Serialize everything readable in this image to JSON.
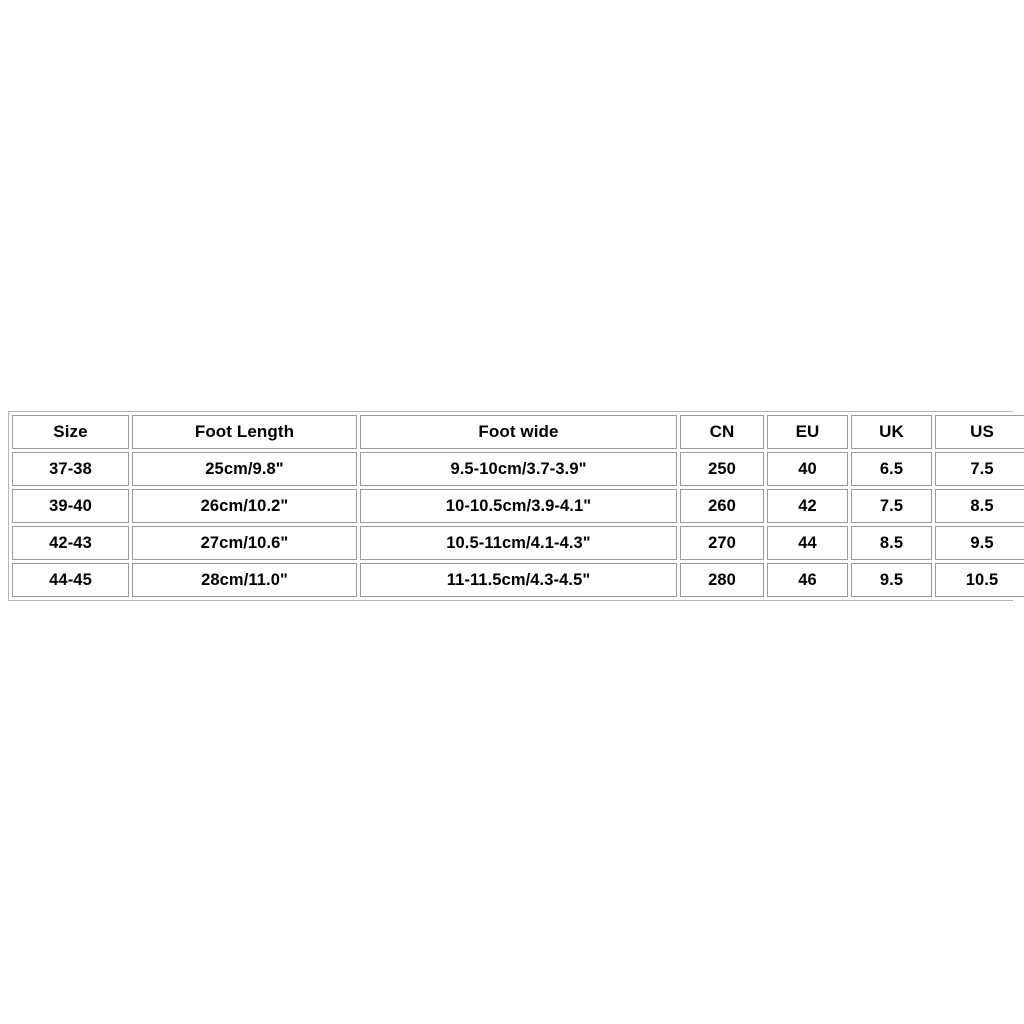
{
  "page": {
    "background_color": "#ffffff",
    "text_color": "#000000",
    "border_color": "#9a9a9a",
    "outer_border_color": "#b4b4b4"
  },
  "size_chart": {
    "headers": [
      "Size",
      "Foot Length",
      "Foot wide",
      "CN",
      "EU",
      "UK",
      "US"
    ],
    "rows": [
      {
        "size": "37-38",
        "foot_length": "25cm/9.8\"",
        "foot_wide": "9.5-10cm/3.7-3.9\"",
        "cn": "250",
        "eu": "40",
        "uk": "6.5",
        "us": "7.5"
      },
      {
        "size": "39-40",
        "foot_length": "26cm/10.2\"",
        "foot_wide": "10-10.5cm/3.9-4.1\"",
        "cn": "260",
        "eu": "42",
        "uk": "7.5",
        "us": "8.5"
      },
      {
        "size": "42-43",
        "foot_length": "27cm/10.6\"",
        "foot_wide": "10.5-11cm/4.1-4.3\"",
        "cn": "270",
        "eu": "44",
        "uk": "8.5",
        "us": "9.5"
      },
      {
        "size": "44-45",
        "foot_length": "28cm/11.0\"",
        "foot_wide": "11-11.5cm/4.3-4.5\"",
        "cn": "280",
        "eu": "46",
        "uk": "9.5",
        "us": "10.5"
      }
    ]
  }
}
